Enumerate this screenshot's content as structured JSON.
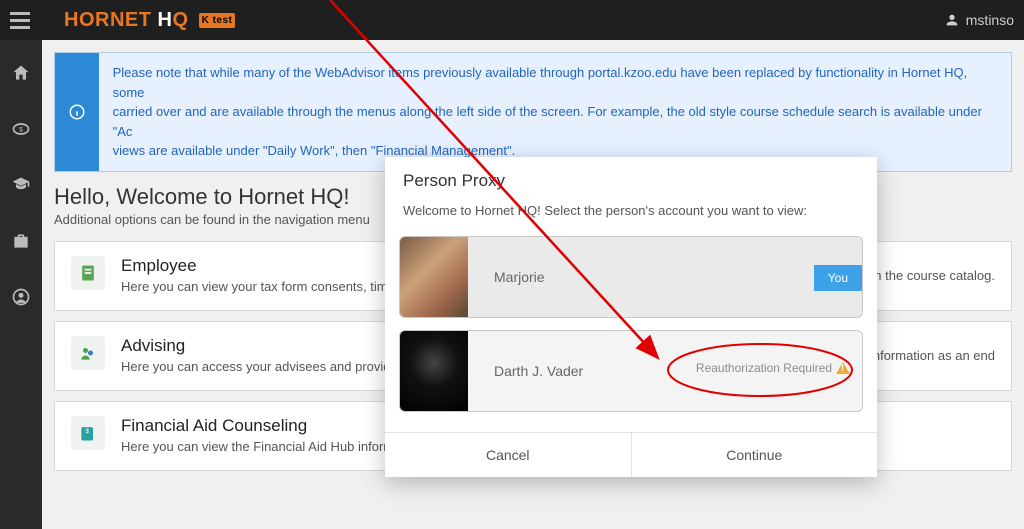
{
  "header": {
    "logo_1": "HORNET",
    "logo_2": " H",
    "logo_3": "Q",
    "ktest": "K test",
    "username": "mstinso"
  },
  "notice": {
    "line1": "Please note that while many of the WebAdvisor items previously available through portal.kzoo.edu have been replaced by functionality in Hornet HQ, some",
    "line2": "carried over and are available through the menus along the left side of the screen. For example, the old style course schedule search is available under \"Ac",
    "line3": "views are available under \"Daily Work\", then \"Financial Management\"."
  },
  "page": {
    "title": "Hello, Welcome to Hornet HQ!",
    "subtitle": "Additional options can be found in the navigation menu"
  },
  "cards": {
    "employee": {
      "title": "Employee",
      "desc": "Here you can view your tax form consents, timecards and leave balances.",
      "right": "rch the course catalog."
    },
    "advising": {
      "title": "Advising",
      "desc": "Here you can access your advisees and provide guidance & feedback on their academic planning.",
      "right": "ng information as an end"
    },
    "fac": {
      "title": "Financial Aid Counseling",
      "desc": "Here you can view the Financial Aid Hub information as a counselor to help the student answer any questions."
    }
  },
  "modal": {
    "title": "Person Proxy",
    "prompt": "Welcome to Hornet HQ! Select the person's account you want to view:",
    "people": [
      {
        "name": "Marjorie",
        "you_label": "You"
      },
      {
        "name": "Darth J. Vader",
        "reauth": "Reauthorization Required"
      }
    ],
    "cancel": "Cancel",
    "continue": "Continue"
  }
}
